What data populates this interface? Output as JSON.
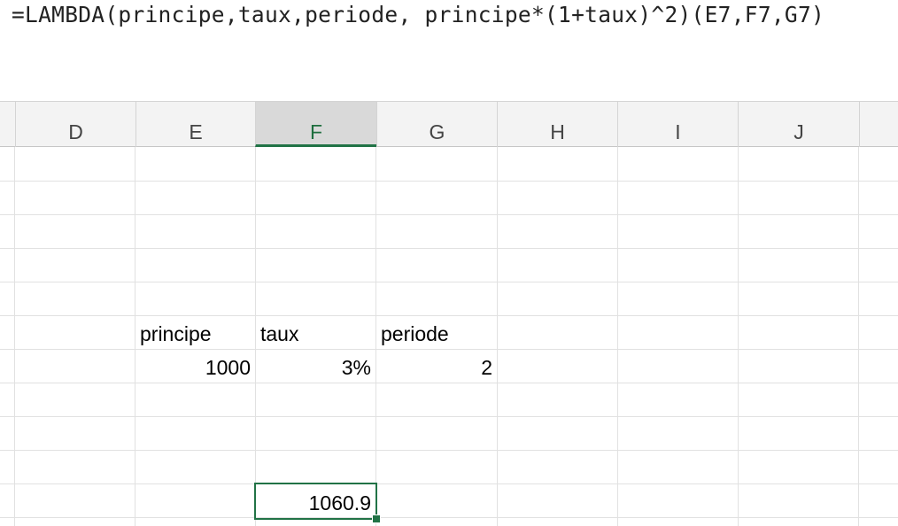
{
  "formula_bar": {
    "formula": "=LAMBDA(principe,taux,periode, principe*(1+taux)^2)(E7,F7,G7)"
  },
  "columns": [
    "D",
    "E",
    "F",
    "G",
    "H",
    "I",
    "J"
  ],
  "selected_column": "F",
  "cells": {
    "E6": "principe",
    "F6": "taux",
    "G6": "periode",
    "E7": "1000",
    "F7": "3%",
    "G7": "2",
    "F11": "1060.9"
  },
  "colors": {
    "selection_green": "#217346",
    "header_bg": "#f3f3f3",
    "gridline": "#e1e1e1"
  }
}
